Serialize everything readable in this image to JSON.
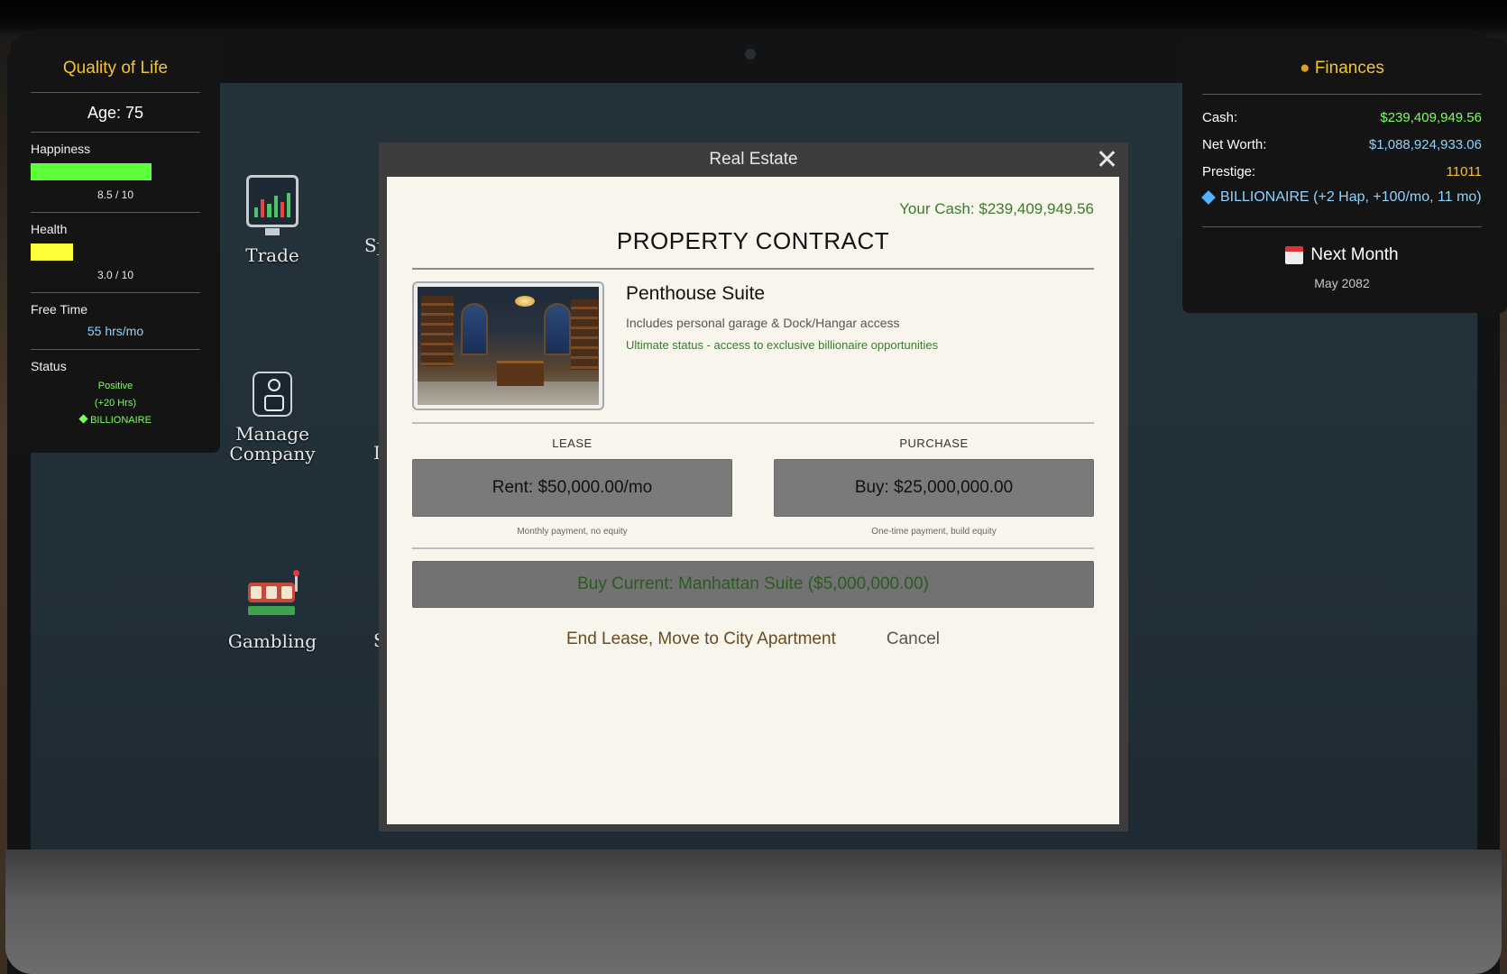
{
  "quality_of_life": {
    "title": "Quality of Life",
    "age": "Age: 75",
    "happiness": {
      "label": "Happiness",
      "value_text": "8.5 / 10",
      "value": 8.5,
      "max": 10,
      "color": "#5cff3a"
    },
    "health": {
      "label": "Health",
      "value_text": "3.0 / 10",
      "value": 3.0,
      "max": 10,
      "color": "#ffff3a"
    },
    "free_time": {
      "label": "Free Time",
      "value": "55 hrs/mo"
    },
    "status": {
      "label": "Status",
      "lines": [
        "Positive",
        "(+20 Hrs)"
      ],
      "badge": "BILLIONAIRE"
    }
  },
  "finances": {
    "title": "Finances",
    "cash_label": "Cash:",
    "cash": "$239,409,949.56",
    "cash_color": "#7cff5a",
    "net_worth_label": "Net Worth:",
    "net_worth": "$1,088,924,933.06",
    "net_worth_color": "#8fd3ff",
    "prestige_label": "Prestige:",
    "prestige": "11011",
    "prestige_color": "#f4c430",
    "badge": "BILLIONAIRE (+2 Hap, +100/mo, 11 mo)",
    "next_month_label": "Next Month",
    "current_month": "May 2082"
  },
  "game_menu": {
    "trade_label": "Trade",
    "manage_company_label_1": "Manage",
    "manage_company_label_2": "Company",
    "gambling_label": "Gambling",
    "partial_sp": "Sp",
    "partial_i": "I",
    "partial_s": "S"
  },
  "modal": {
    "title": "Real Estate",
    "your_cash": "Your Cash: $239,409,949.56",
    "heading": "PROPERTY CONTRACT",
    "property": {
      "name": "Penthouse Suite",
      "description": "Includes personal garage & Dock/Hangar access",
      "perk": "Ultimate status - access to exclusive billionaire opportunities"
    },
    "lease": {
      "heading": "LEASE",
      "button": "Rent: $50,000.00/mo",
      "note": "Monthly payment, no equity"
    },
    "purchase": {
      "heading": "PURCHASE",
      "button": "Buy: $25,000,000.00",
      "note": "One-time payment, build equity"
    },
    "buy_current": "Buy Current: Manhattan Suite ($5,000,000.00)",
    "end_lease": "End Lease, Move to City Apartment",
    "cancel": "Cancel"
  }
}
